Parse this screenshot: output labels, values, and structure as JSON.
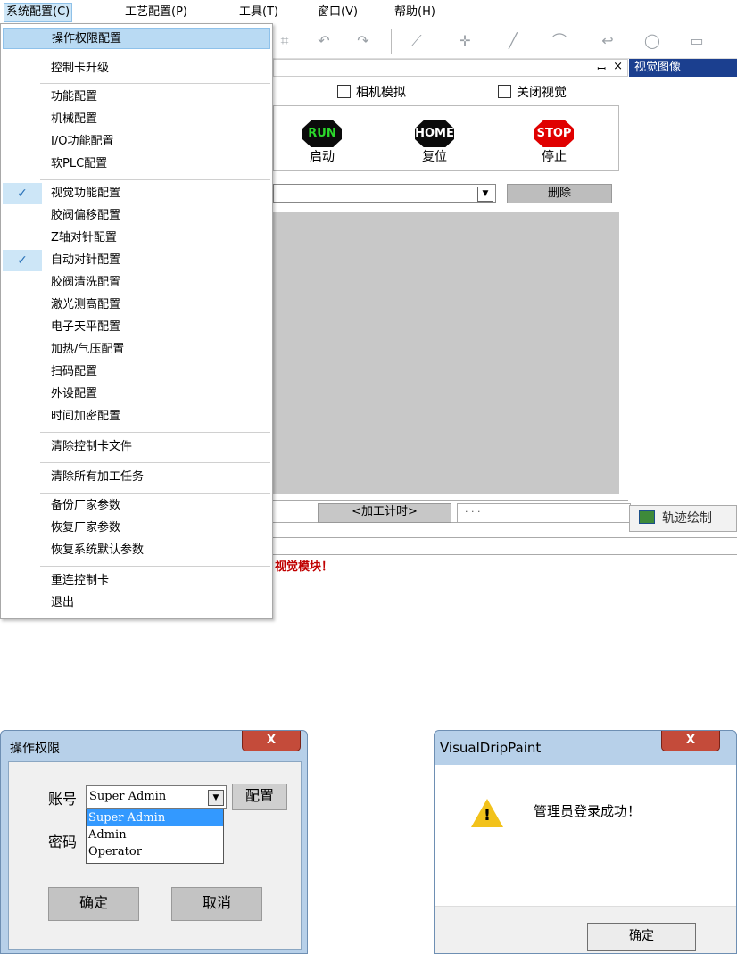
{
  "menubar": {
    "items": [
      "系统配置(C)",
      "工艺配置(P)",
      "工具(T)",
      "窗口(V)",
      "帮助(H)"
    ]
  },
  "dropdown": {
    "items": [
      {
        "label": "操作权限配置",
        "highlighted": true
      },
      {
        "label": "控制卡升级"
      },
      {
        "label": "功能配置"
      },
      {
        "label": "机械配置"
      },
      {
        "label": "I/O功能配置"
      },
      {
        "label": "软PLC配置"
      },
      {
        "label": "视觉功能配置",
        "checked": true
      },
      {
        "label": "胶阀偏移配置"
      },
      {
        "label": "Z轴对针配置"
      },
      {
        "label": "自动对针配置",
        "checked": true
      },
      {
        "label": "胶阀清洗配置"
      },
      {
        "label": "激光测高配置"
      },
      {
        "label": "电子天平配置"
      },
      {
        "label": "加热/气压配置"
      },
      {
        "label": "扫码配置"
      },
      {
        "label": "外设配置"
      },
      {
        "label": "时间加密配置"
      },
      {
        "label": "清除控制卡文件"
      },
      {
        "label": "清除所有加工任务"
      },
      {
        "label": "备份厂家参数"
      },
      {
        "label": "恢复厂家参数"
      },
      {
        "label": "恢复系统默认参数"
      },
      {
        "label": "重连控制卡"
      },
      {
        "label": "退出"
      }
    ]
  },
  "panel": {
    "pin": "ꟷ",
    "close": "×",
    "camera_sim": "相机模拟",
    "close_vision": "关闭视觉",
    "run": {
      "icon": "RUN",
      "label": "启动",
      "color": "#0b0b0b",
      "text_color": "#2bd92b"
    },
    "home": {
      "icon": "HOME",
      "label": "复位",
      "color": "#0b0b0b",
      "text_color": "#ffffff"
    },
    "stop": {
      "icon": "STOP",
      "label": "停止",
      "color": "#e00000",
      "text_color": "#ffffff"
    },
    "delete": "删除",
    "timer": "<加工计时>",
    "dots": "· · ·",
    "message": "视觉模块！"
  },
  "vision": {
    "title": "视觉图像",
    "trajectory_tab": "轨迹绘制"
  },
  "dialog_permission": {
    "title": "操作权限",
    "close": "X",
    "account_label": "账号",
    "password_label": "密码",
    "account_value": "Super Admin",
    "config_button": "配置",
    "options": [
      "Super Admin",
      "Admin",
      "Operator"
    ],
    "ok": "确定",
    "cancel": "取消"
  },
  "dialog_message": {
    "title": "VisualDripPaint",
    "close": "X",
    "message": "管理员登录成功！",
    "ok": "确定"
  }
}
